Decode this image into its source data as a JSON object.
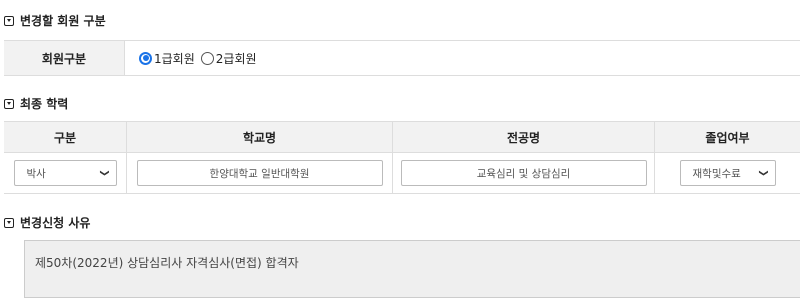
{
  "sections": {
    "member_type": {
      "title": "변경할 회원 구분",
      "label": "회원구분",
      "options": [
        {
          "label": "1급회원",
          "checked": true
        },
        {
          "label": "2급회원",
          "checked": false
        }
      ]
    },
    "education": {
      "title": "최종 학력",
      "headers": [
        "구분",
        "학교명",
        "전공명",
        "졸업여부"
      ],
      "degree": "박사",
      "school": "한양대학교 일반대학원",
      "major": "교육심리 및 상담심리",
      "graduation": "재학및수료"
    },
    "reason": {
      "title": "변경신청 사유",
      "text": "제50차(2022년) 상담심리사 자격심사(면접) 합격자"
    }
  },
  "colors": {
    "radio_accent": "#1a73e8",
    "header_bg": "#f2f2f2",
    "reason_bg": "#efefef"
  },
  "icons": {
    "section_icon": "collapse-square-icon",
    "select_icon": "chevron-down-icon"
  }
}
